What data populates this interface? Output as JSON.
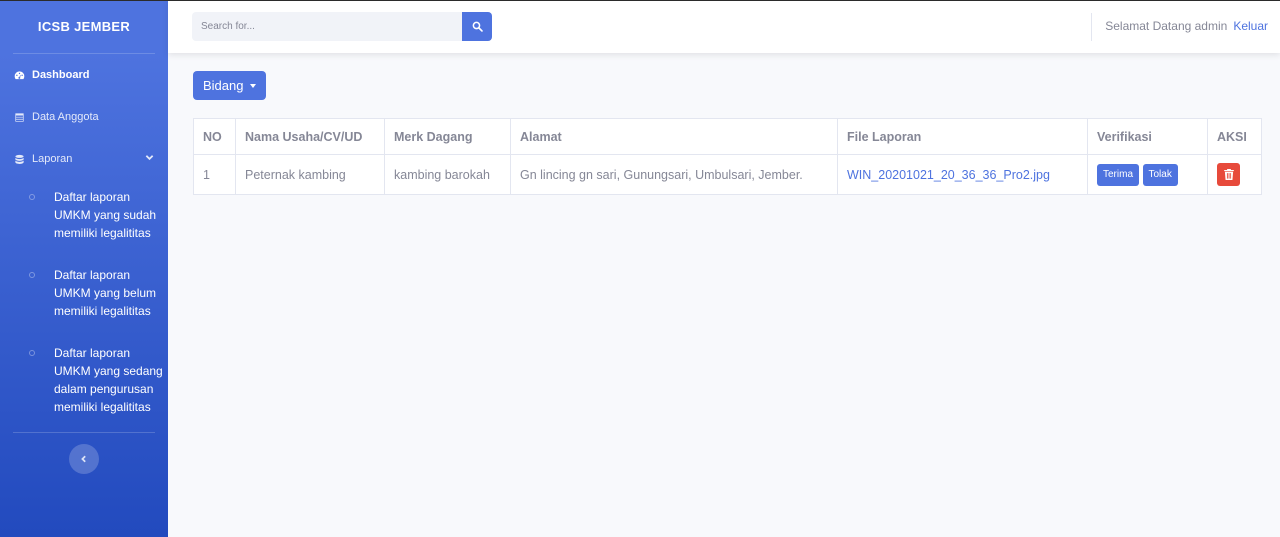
{
  "sidebar": {
    "brand": "ICSB JEMBER",
    "items": [
      {
        "label": "Dashboard",
        "icon": "dashboard-icon"
      },
      {
        "label": "Data Anggota",
        "icon": "table-icon"
      },
      {
        "label": "Laporan",
        "icon": "database-icon"
      }
    ],
    "submenu": [
      "Daftar laporan UMKM yang sudah memiliki legalititas",
      "Daftar laporan UMKM yang belum memiliki legalititas",
      "Daftar laporan UMKM yang sedang dalam pengurusan memiliki legalititas"
    ]
  },
  "topbar": {
    "search_placeholder": "Search for...",
    "welcome": "Selamat Datang admin",
    "logout": "Keluar"
  },
  "main": {
    "dropdown_label": "Bidang",
    "table": {
      "headers": [
        "NO",
        "Nama Usaha/CV/UD",
        "Merk Dagang",
        "Alamat",
        "File Laporan",
        "Verifikasi",
        "AKSI"
      ],
      "rows": [
        {
          "no": "1",
          "nama": "Peternak kambing",
          "merk": "kambing barokah",
          "alamat": "Gn lincing gn sari, Gunungsari, Umbulsari, Jember.",
          "file": "WIN_20201021_20_36_36_Pro2.jpg",
          "accept": "Terima",
          "reject": "Tolak"
        }
      ]
    }
  },
  "colors": {
    "primary": "#4e73df",
    "danger": "#e74a3b",
    "text_muted": "#858796"
  }
}
